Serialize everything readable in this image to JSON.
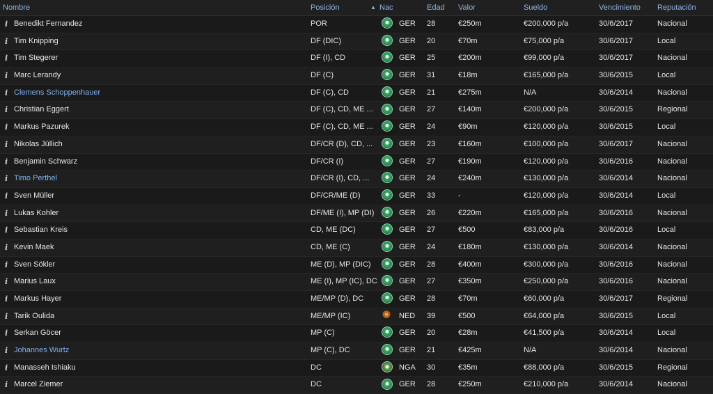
{
  "columns": {
    "name": "Nombre",
    "position": "Posición",
    "nation": "Nac",
    "age": "Edad",
    "value": "Valor",
    "wage": "Sueldo",
    "expires": "Vencimiento",
    "reputation": "Reputación"
  },
  "sort": {
    "column": "position",
    "direction": "ascending",
    "icon": "sort-up-arrow-icon"
  },
  "info_glyph": "i",
  "rows": [
    {
      "name": "Benedikt Fernandez",
      "loan": false,
      "position": "POR",
      "flag": "ger",
      "nation": "GER",
      "age": "28",
      "value": "€250m",
      "wage": "€200,000 p/a",
      "expires": "30/6/2017",
      "reputation": "Nacional"
    },
    {
      "name": "Tim Knipping",
      "loan": false,
      "position": "DF (DIC)",
      "flag": "ger",
      "nation": "GER",
      "age": "20",
      "value": "€70m",
      "wage": "€75,000 p/a",
      "expires": "30/6/2017",
      "reputation": "Local"
    },
    {
      "name": "Tim Stegerer",
      "loan": false,
      "position": "DF (I), CD",
      "flag": "ger",
      "nation": "GER",
      "age": "25",
      "value": "€200m",
      "wage": "€99,000 p/a",
      "expires": "30/6/2017",
      "reputation": "Nacional"
    },
    {
      "name": "Marc Lerandy",
      "loan": false,
      "position": "DF (C)",
      "flag": "ger",
      "nation": "GER",
      "age": "31",
      "value": "€18m",
      "wage": "€165,000 p/a",
      "expires": "30/6/2015",
      "reputation": "Local"
    },
    {
      "name": "Clemens Schoppenhauer",
      "loan": true,
      "position": "DF (C), CD",
      "flag": "ger",
      "nation": "GER",
      "age": "21",
      "value": "€275m",
      "wage": "N/A",
      "expires": "30/6/2014",
      "reputation": "Nacional"
    },
    {
      "name": "Christian Eggert",
      "loan": false,
      "position": "DF (C), CD, ME ...",
      "flag": "ger",
      "nation": "GER",
      "age": "27",
      "value": "€140m",
      "wage": "€200,000 p/a",
      "expires": "30/6/2015",
      "reputation": "Regional"
    },
    {
      "name": "Markus Pazurek",
      "loan": false,
      "position": "DF (C), CD, ME ...",
      "flag": "ger",
      "nation": "GER",
      "age": "24",
      "value": "€90m",
      "wage": "€120,000 p/a",
      "expires": "30/6/2015",
      "reputation": "Local"
    },
    {
      "name": "Nikolas Jüllich",
      "loan": false,
      "position": "DF/CR (D), CD, ...",
      "flag": "ger",
      "nation": "GER",
      "age": "23",
      "value": "€160m",
      "wage": "€100,000 p/a",
      "expires": "30/6/2017",
      "reputation": "Nacional"
    },
    {
      "name": "Benjamin Schwarz",
      "loan": false,
      "position": "DF/CR (I)",
      "flag": "ger",
      "nation": "GER",
      "age": "27",
      "value": "€190m",
      "wage": "€120,000 p/a",
      "expires": "30/6/2016",
      "reputation": "Nacional"
    },
    {
      "name": "Timo Perthel",
      "loan": true,
      "position": "DF/CR (I), CD, ...",
      "flag": "ger",
      "nation": "GER",
      "age": "24",
      "value": "€240m",
      "wage": "€130,000 p/a",
      "expires": "30/6/2014",
      "reputation": "Nacional"
    },
    {
      "name": "Sven Müller",
      "loan": false,
      "position": "DF/CR/ME (D)",
      "flag": "ger",
      "nation": "GER",
      "age": "33",
      "value": "-",
      "wage": "€120,000 p/a",
      "expires": "30/6/2014",
      "reputation": "Local"
    },
    {
      "name": "Lukas Kohler",
      "loan": false,
      "position": "DF/ME (I), MP (DI)",
      "flag": "ger",
      "nation": "GER",
      "age": "26",
      "value": "€220m",
      "wage": "€165,000 p/a",
      "expires": "30/6/2016",
      "reputation": "Nacional"
    },
    {
      "name": "Sebastian Kreis",
      "loan": false,
      "position": "CD, ME (DC)",
      "flag": "ger",
      "nation": "GER",
      "age": "27",
      "value": "€500",
      "wage": "€83,000 p/a",
      "expires": "30/6/2016",
      "reputation": "Local"
    },
    {
      "name": "Kevin Maek",
      "loan": false,
      "position": "CD, ME (C)",
      "flag": "ger",
      "nation": "GER",
      "age": "24",
      "value": "€180m",
      "wage": "€130,000 p/a",
      "expires": "30/6/2014",
      "reputation": "Nacional"
    },
    {
      "name": "Sven Sökler",
      "loan": false,
      "position": "ME (D), MP (DIC)",
      "flag": "ger",
      "nation": "GER",
      "age": "28",
      "value": "€400m",
      "wage": "€300,000 p/a",
      "expires": "30/6/2016",
      "reputation": "Nacional"
    },
    {
      "name": "Marius Laux",
      "loan": false,
      "position": "ME (I), MP (IC), DC",
      "flag": "ger",
      "nation": "GER",
      "age": "27",
      "value": "€350m",
      "wage": "€250,000 p/a",
      "expires": "30/6/2016",
      "reputation": "Nacional"
    },
    {
      "name": "Markus Hayer",
      "loan": false,
      "position": "ME/MP (D), DC",
      "flag": "ger",
      "nation": "GER",
      "age": "28",
      "value": "€70m",
      "wage": "€60,000 p/a",
      "expires": "30/6/2017",
      "reputation": "Regional"
    },
    {
      "name": "Tarik Oulida",
      "loan": false,
      "position": "ME/MP (IC)",
      "flag": "ned",
      "nation": "NED",
      "age": "39",
      "value": "€500",
      "wage": "€64,000 p/a",
      "expires": "30/6/2015",
      "reputation": "Local"
    },
    {
      "name": "Serkan Göcer",
      "loan": false,
      "position": "MP (C)",
      "flag": "ger",
      "nation": "GER",
      "age": "20",
      "value": "€28m",
      "wage": "€41,500 p/a",
      "expires": "30/6/2014",
      "reputation": "Local"
    },
    {
      "name": "Johannes Wurtz",
      "loan": true,
      "position": "MP (C), DC",
      "flag": "ger",
      "nation": "GER",
      "age": "21",
      "value": "€425m",
      "wage": "N/A",
      "expires": "30/6/2014",
      "reputation": "Nacional"
    },
    {
      "name": "Manasseh Ishiaku",
      "loan": false,
      "position": "DC",
      "flag": "nga",
      "nation": "NGA",
      "age": "30",
      "value": "€35m",
      "wage": "€88,000 p/a",
      "expires": "30/6/2015",
      "reputation": "Regional"
    },
    {
      "name": "Marcel Ziemer",
      "loan": false,
      "position": "DC",
      "flag": "ger",
      "nation": "GER",
      "age": "28",
      "value": "€250m",
      "wage": "€210,000 p/a",
      "expires": "30/6/2014",
      "reputation": "Nacional"
    }
  ]
}
